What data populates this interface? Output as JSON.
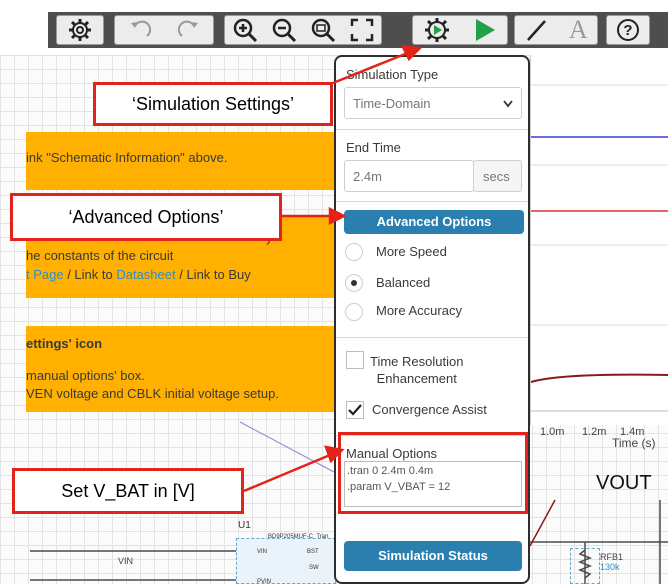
{
  "toolbar": {
    "buttons": [
      "gear-icon",
      "undo-icon",
      "redo-icon",
      "zoom-in-icon",
      "zoom-out-icon",
      "zoom-fit-icon",
      "fullscreen-icon",
      "simulation-settings-icon",
      "run-icon",
      "wire-icon",
      "text-icon",
      "help-icon"
    ],
    "text_tool_glyph": "A",
    "help_glyph": "?"
  },
  "left_notes": {
    "box1_text": "ink \"Schematic Information\" above.",
    "box2_line1": "y",
    "box2_line2": "he constants of the circuit",
    "box2_line3_a": "t Page",
    "box2_line3_sep1": " / Link to ",
    "box2_line3_b": "Datasheet",
    "box2_line3_sep2": " / Link to Buy",
    "box3_title": "ettings' icon",
    "box3_line1": "manual options' box.",
    "box3_line2": "VEN voltage and CBLK initial voltage setup."
  },
  "panel": {
    "sim_type_label": "Simulation Type",
    "sim_type_value": "Time-Domain",
    "end_time_label": "End Time",
    "end_time_value": "2.4m",
    "end_time_unit": "secs",
    "advanced_button": "Advanced Options",
    "radio_options": [
      "More Speed",
      "Balanced",
      "More Accuracy"
    ],
    "selected_radio": "Balanced",
    "time_res_label_1": "Time Resolution",
    "time_res_label_2": "Enhancement",
    "time_res_checked": false,
    "convergence_label": "Convergence Assist",
    "convergence_checked": true,
    "manual_label": "Manual Options",
    "manual_line1": ".tran 0 2.4m 0.4m",
    "manual_line2": ".param V_VBAT = 12",
    "status_button": "Simulation Status"
  },
  "plot": {
    "x_ticks": [
      "1.0m",
      "1.2m",
      "1.4m"
    ],
    "x_label": "Time (s)",
    "series_colors": [
      "#3b3bd6",
      "#e03030",
      "#8b1a1a"
    ]
  },
  "schematic": {
    "net_label": "VOUT",
    "vin_label": "VIN",
    "u1_label": "U1",
    "u1_part": "BD9P205MUF-C_Tran",
    "rfb1_label": "RFB1",
    "rfb1_value": "130k",
    "u1_pins": [
      "VIN",
      "PVIN",
      "BST",
      "SW"
    ]
  },
  "callouts": {
    "sim_settings": "‘Simulation Settings’",
    "advanced": "‘Advanced Options’",
    "vbat": "Set V_BAT in [V]"
  },
  "colors": {
    "accent_blue": "#2a7fae",
    "callout_red": "#e2231a",
    "note_orange": "#ffb000",
    "toolbar_dark": "#4e4e4e"
  }
}
